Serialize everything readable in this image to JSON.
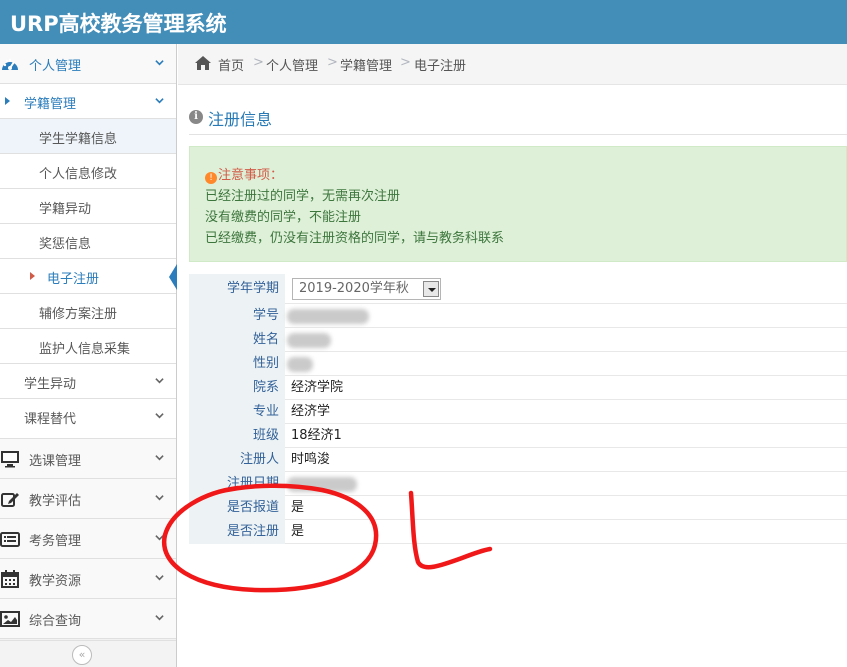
{
  "app": {
    "title": "URP高校教务管理系统"
  },
  "sidebar": {
    "top_items": [
      {
        "label": "个人管理",
        "icon": "dashboard-icon"
      },
      {
        "label": "选课管理",
        "icon": "monitor-icon"
      },
      {
        "label": "教学评估",
        "icon": "edit-icon"
      },
      {
        "label": "考务管理",
        "icon": "list-icon"
      },
      {
        "label": "教学资源",
        "icon": "calendar-icon"
      },
      {
        "label": "综合查询",
        "icon": "picture-icon"
      }
    ],
    "sub_items": [
      {
        "label": "学籍管理"
      },
      {
        "label": "学生异动"
      },
      {
        "label": "课程替代"
      }
    ],
    "leaf_items": [
      {
        "label": "学生学籍信息"
      },
      {
        "label": "个人信息修改"
      },
      {
        "label": "学籍异动"
      },
      {
        "label": "奖惩信息"
      },
      {
        "label": "电子注册"
      },
      {
        "label": "辅修方案注册"
      },
      {
        "label": "监护人信息采集"
      }
    ],
    "collapse_glyph": "«"
  },
  "breadcrumb": {
    "items": [
      "首页",
      "个人管理",
      "学籍管理",
      "电子注册"
    ],
    "separator": ">"
  },
  "section": {
    "title": "注册信息",
    "info_glyph": "i"
  },
  "notice": {
    "heading": "注意事项：",
    "warn_glyph": "!",
    "lines": [
      "已经注册过的同学，无需再次注册",
      "没有缴费的同学，不能注册",
      "已经缴费，仍没有注册资格的同学，请与教务科联系"
    ]
  },
  "form": {
    "term_label": "学年学期",
    "term_selected": "2019-2020学年秋",
    "rows": [
      {
        "label": "学号",
        "value": ""
      },
      {
        "label": "姓名",
        "value": ""
      },
      {
        "label": "性别",
        "value": ""
      },
      {
        "label": "院系",
        "value": "经济学院"
      },
      {
        "label": "专业",
        "value": "经济学"
      },
      {
        "label": "班级",
        "value": "18经济1"
      },
      {
        "label": "注册人",
        "value": "时鸣浚"
      },
      {
        "label": "注册日期",
        "value": ""
      },
      {
        "label": "是否报道",
        "value": "是"
      },
      {
        "label": "是否注册",
        "value": "是"
      }
    ]
  },
  "colors": {
    "header": "#438eb9",
    "link": "#2b7dbc",
    "notice_bg": "#dff0d8",
    "annotation": "#f01818"
  }
}
